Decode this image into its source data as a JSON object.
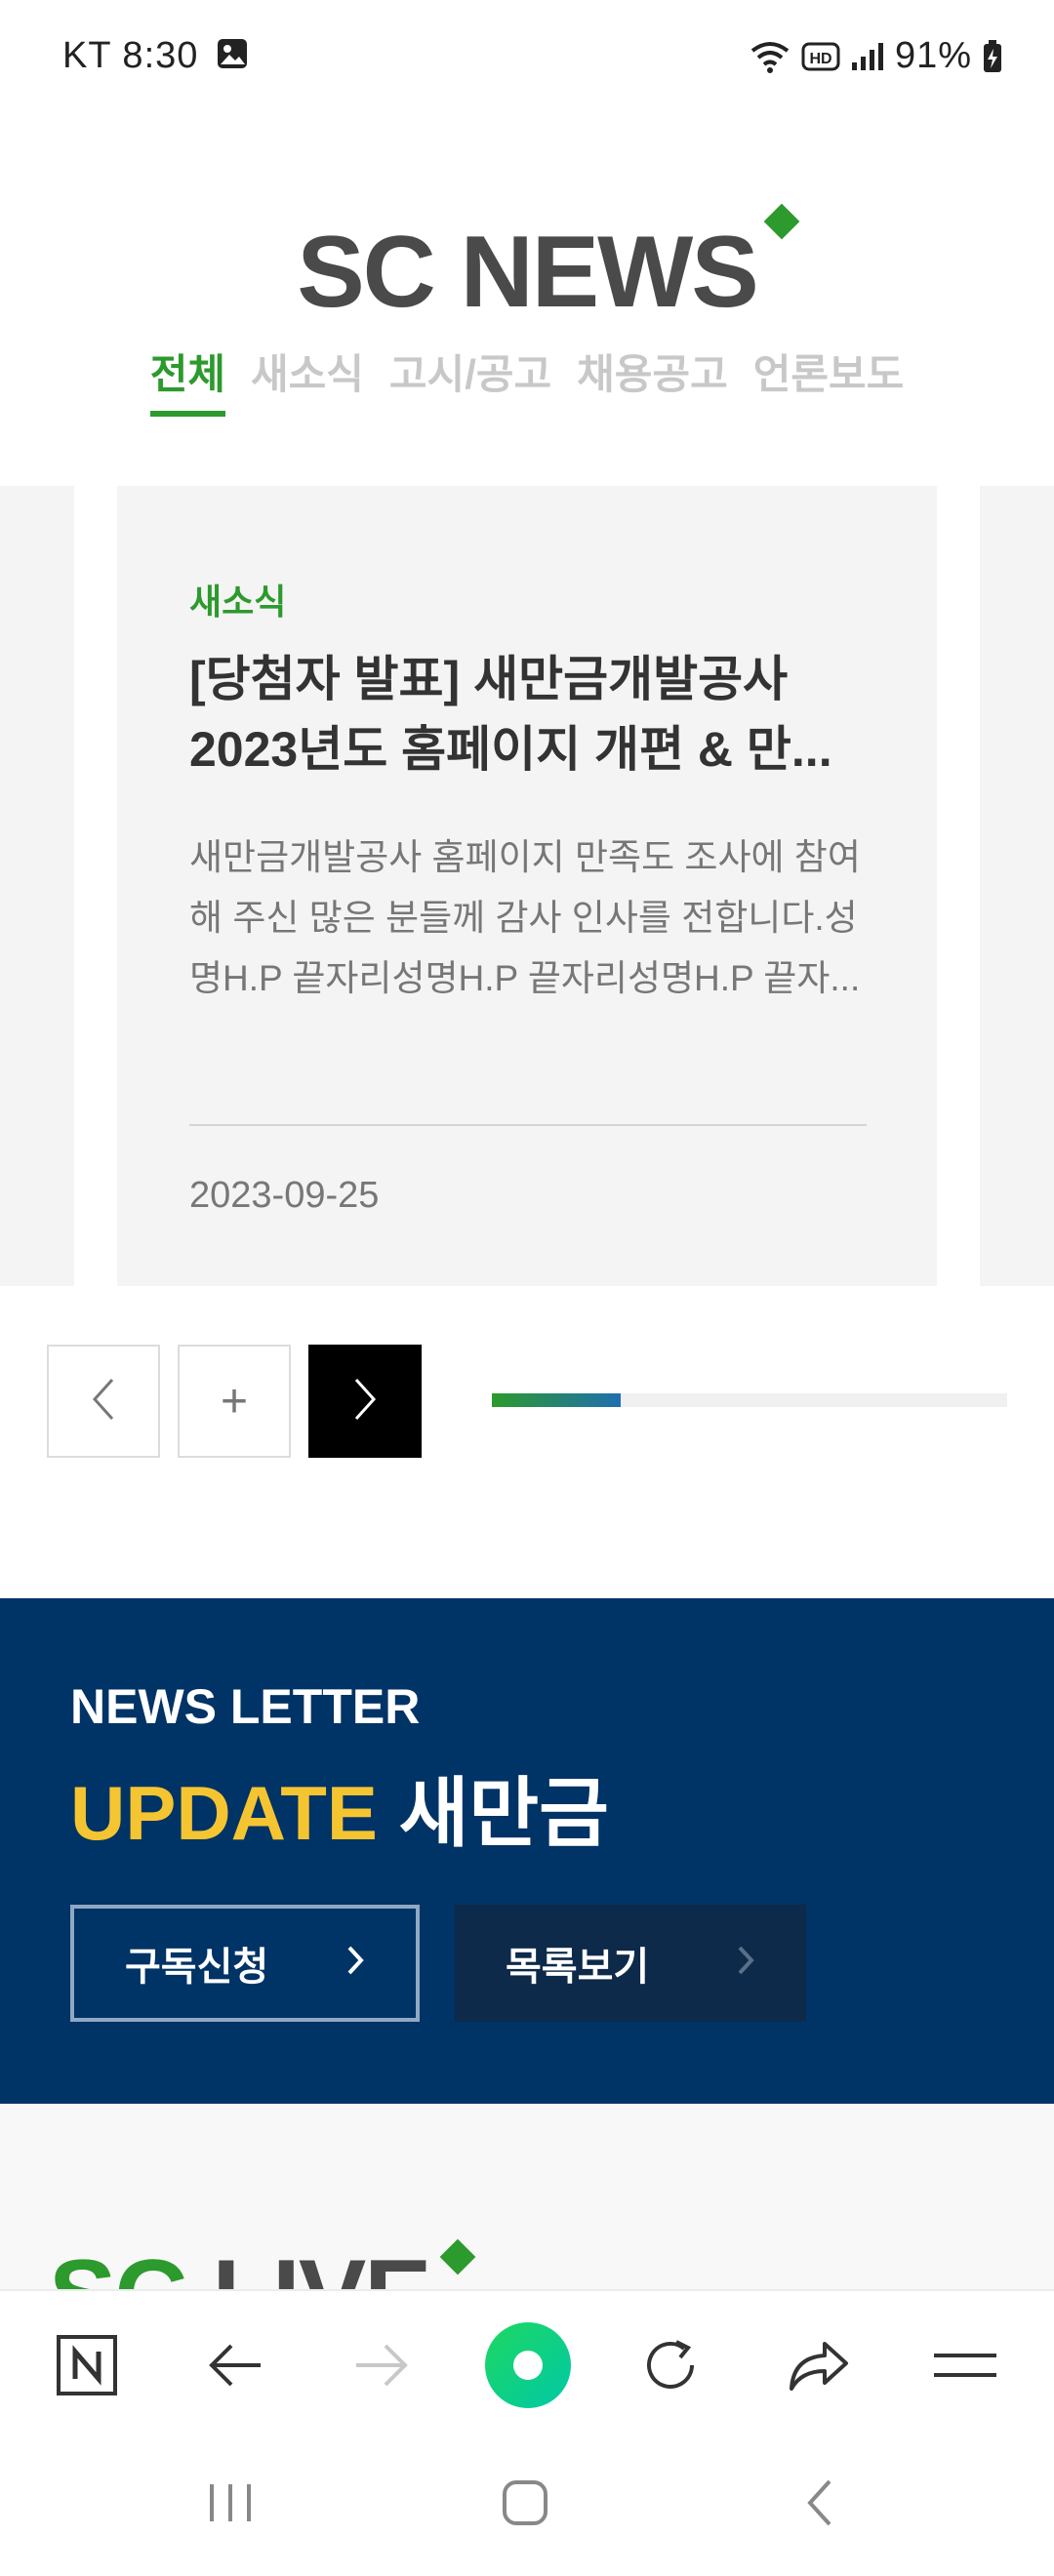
{
  "status_bar": {
    "carrier_time": "KT 8:30",
    "battery": "91%"
  },
  "news": {
    "title": "SC NEWS",
    "tabs": [
      {
        "label": "전체",
        "active": true
      },
      {
        "label": "새소식",
        "active": false
      },
      {
        "label": "고시/공고",
        "active": false
      },
      {
        "label": "채용공고",
        "active": false
      },
      {
        "label": "언론보도",
        "active": false
      }
    ],
    "card": {
      "category": "새소식",
      "title": "[당첨자 발표] 새만금개발공사 2023년도 홈페이지 개편 & 만...",
      "description": "새만금개발공사 홈페이지 만족도 조사에 참여해 주신 많은 분들께 감사 인사를 전합니다.성명H.P 끝자리성명H.P 끝자리성명H.P 끝자...",
      "date": "2023-09-25"
    },
    "controls": {
      "plus": "+"
    },
    "progress": 0.25
  },
  "newsletter": {
    "label": "NEWS LETTER",
    "headline_accent": "UPDATE",
    "headline_rest": "새만금",
    "subscribe_label": "구독신청",
    "list_label": "목록보기"
  },
  "live": {
    "title_sc": "SC",
    "title_rest": "LIVE"
  },
  "colors": {
    "accent_green": "#2c9a2c",
    "newsletter_bg": "#003366",
    "update_yellow": "#f5c531"
  }
}
